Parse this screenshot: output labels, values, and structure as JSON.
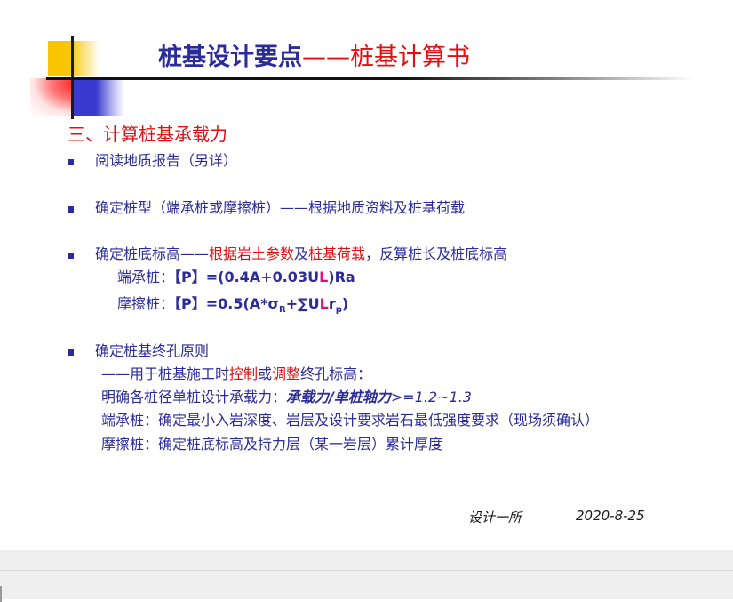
{
  "title": {
    "main": "桩基设计要点",
    "sub": "——桩基计算书"
  },
  "section": "三、计算桩基承载力",
  "items": [
    {
      "text": "阅读地质报告（另详）"
    },
    {
      "text": "确定桩型（端承桩或摩擦桩）——根据地质资料及桩基荷载"
    },
    {
      "pre": "确定桩底标高——",
      "red1": "根据岩土参数",
      "mid": "及",
      "red2": "桩基荷载",
      "post": "，反算桩长及桩底标高",
      "formulas": [
        {
          "label": "端承桩：",
          "a": "【P】=(0.4A+0.03U",
          "l": "L",
          "b": ")Ra"
        },
        {
          "label": "摩擦桩：",
          "a": "【P】=0.5(A*σ",
          "sub1": "R",
          "c": "+∑U",
          "l": "L",
          "d": "r",
          "sub2": "p",
          "e": ")"
        }
      ]
    },
    {
      "text": "确定桩基终孔原则",
      "lines": {
        "l1_pre": "——用于桩基施工时",
        "l1_red1": "控制",
        "l1_mid": "或",
        "l1_red2": "调整",
        "l1_post": "终孔标高：",
        "l2_pre": "明确各桩径单桩设计承载力：",
        "l2_ratio": "承载力/单桩轴力",
        "l2_val": ">=1.2~1.3",
        "l3": "端承桩：确定最小入岩深度、岩层及设计要求岩石最低强度要求（现场须确认）",
        "l4": "摩擦桩：确定桩底标高及持力层（某一岩层）累计厚度"
      }
    }
  ],
  "footer": {
    "dept": "设计一所",
    "date": "2020-8-25"
  },
  "colors": {
    "title_blue": "#2b2b9a",
    "accent_red": "#e01010",
    "logo_yellow": "#f7c600",
    "logo_blue": "#3a3ad0"
  }
}
